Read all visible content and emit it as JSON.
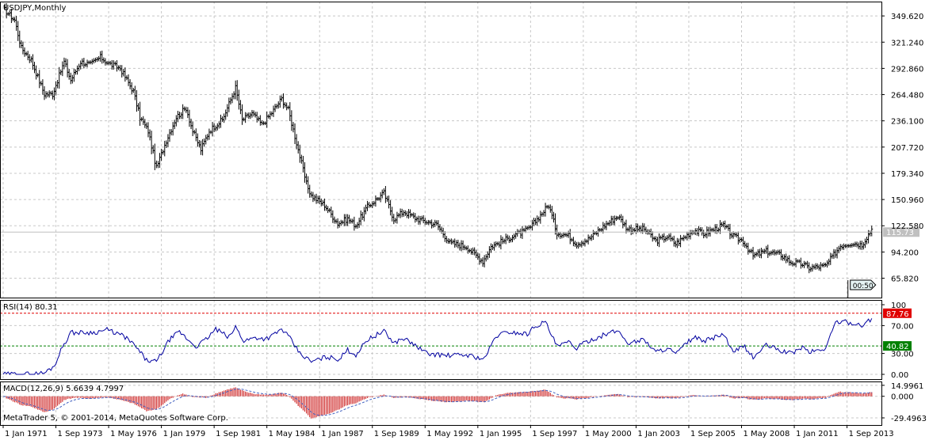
{
  "chart_data": [
    {
      "type": "ohlc",
      "symbol_label": "USDJPY,Monthly",
      "ylim": [
        50,
        360
      ],
      "yticks": [
        349.62,
        321.24,
        292.86,
        264.48,
        236.1,
        207.72,
        179.34,
        150.96,
        122.58,
        94.2,
        65.82
      ],
      "ytick_labels": [
        "349.620",
        "321.240",
        "292.860",
        "264.480",
        "236.100",
        "207.720",
        "179.340",
        "150.960",
        "122.580",
        "94.200",
        "65.820"
      ],
      "last_price": 115.73,
      "last_price_label": "115.73",
      "timer_label": "00:50",
      "colors": {
        "bars": "#000000",
        "price_line": "#c0c0c0",
        "price_label_bg": "#c0c0c0"
      },
      "anchors": [
        [
          "1971-01",
          358
        ],
        [
          "1971-08",
          345
        ],
        [
          "1971-12",
          315
        ],
        [
          "1972-06",
          302
        ],
        [
          "1973-02",
          265
        ],
        [
          "1973-07",
          265
        ],
        [
          "1974-02",
          300
        ],
        [
          "1974-06",
          280
        ],
        [
          "1974-12",
          300
        ],
        [
          "1975-06",
          297
        ],
        [
          "1975-12",
          305
        ],
        [
          "1976-05",
          298
        ],
        [
          "1976-12",
          293
        ],
        [
          "1977-08",
          268
        ],
        [
          "1977-12",
          240
        ],
        [
          "1978-05",
          225
        ],
        [
          "1978-10",
          185
        ],
        [
          "1979-04",
          215
        ],
        [
          "1979-10",
          240
        ],
        [
          "1980-04",
          250
        ],
        [
          "1980-08",
          225
        ],
        [
          "1981-01",
          205
        ],
        [
          "1981-06",
          225
        ],
        [
          "1981-09",
          230
        ],
        [
          "1982-02",
          237
        ],
        [
          "1982-10",
          272
        ],
        [
          "1983-02",
          237
        ],
        [
          "1983-08",
          244
        ],
        [
          "1984-02",
          232
        ],
        [
          "1984-08",
          245
        ],
        [
          "1985-02",
          260
        ],
        [
          "1985-06",
          248
        ],
        [
          "1985-12",
          205
        ],
        [
          "1986-05",
          168
        ],
        [
          "1986-08",
          155
        ],
        [
          "1987-04",
          145
        ],
        [
          "1987-12",
          125
        ],
        [
          "1988-06",
          130
        ],
        [
          "1988-11",
          123
        ],
        [
          "1989-06",
          143
        ],
        [
          "1990-04",
          158
        ],
        [
          "1990-10",
          130
        ],
        [
          "1991-04",
          138
        ],
        [
          "1991-12",
          130
        ],
        [
          "1992-06",
          127
        ],
        [
          "1992-12",
          124
        ],
        [
          "1993-08",
          104
        ],
        [
          "1994-06",
          100
        ],
        [
          "1995-04",
          84
        ],
        [
          "1995-09",
          100
        ],
        [
          "1996-04",
          106
        ],
        [
          "1996-12",
          113
        ],
        [
          "1997-05",
          116
        ],
        [
          "1997-09",
          121
        ],
        [
          "1998-08",
          145
        ],
        [
          "1999-01",
          115
        ],
        [
          "1999-08",
          112
        ],
        [
          "2000-01",
          103
        ],
        [
          "2000-08",
          108
        ],
        [
          "2001-06",
          123
        ],
        [
          "2002-02",
          133
        ],
        [
          "2002-08",
          119
        ],
        [
          "2003-06",
          119
        ],
        [
          "2004-01",
          106
        ],
        [
          "2004-08",
          111
        ],
        [
          "2005-01",
          103
        ],
        [
          "2005-12",
          118
        ],
        [
          "2006-06",
          114
        ],
        [
          "2007-06",
          123
        ],
        [
          "2007-12",
          111
        ],
        [
          "2008-06",
          106
        ],
        [
          "2008-12",
          90
        ],
        [
          "2009-08",
          95
        ],
        [
          "2010-05",
          91
        ],
        [
          "2010-11",
          83
        ],
        [
          "2011-06",
          81
        ],
        [
          "2011-10",
          77
        ],
        [
          "2012-08",
          79
        ],
        [
          "2013-05",
          101
        ],
        [
          "2013-12",
          104
        ],
        [
          "2014-06",
          102
        ],
        [
          "2014-12",
          119
        ]
      ]
    },
    {
      "type": "line",
      "label": "RSI(14) 80.31",
      "ylim": [
        0,
        100
      ],
      "yticks": [
        100,
        70,
        30,
        0
      ],
      "ytick_labels": [
        "100",
        "70.00",
        "30.00",
        "0.00"
      ],
      "levels": [
        87.76,
        40.82
      ],
      "level_labels": [
        "87.76",
        "40.82"
      ],
      "colors": {
        "line": "#0000a0",
        "upper_level": "#e00000",
        "lower_level": "#008000",
        "upper_label_bg": "#e00000",
        "lower_label_bg": "#008000"
      },
      "anchors": [
        [
          "1971-01",
          0
        ],
        [
          "1972-06",
          0.5
        ],
        [
          "1973-02",
          2
        ],
        [
          "1973-08",
          12
        ],
        [
          "1974-01",
          40
        ],
        [
          "1974-06",
          60
        ],
        [
          "1974-12",
          60
        ],
        [
          "1975-08",
          60
        ],
        [
          "1976-04",
          64
        ],
        [
          "1976-12",
          57
        ],
        [
          "1977-04",
          52
        ],
        [
          "1977-10",
          38
        ],
        [
          "1978-04",
          20
        ],
        [
          "1978-10",
          18
        ],
        [
          "1979-06",
          50
        ],
        [
          "1979-12",
          61
        ],
        [
          "1980-05",
          50
        ],
        [
          "1980-10",
          40
        ],
        [
          "1981-04",
          50
        ],
        [
          "1981-10",
          65
        ],
        [
          "1982-06",
          53
        ],
        [
          "1982-10",
          68
        ],
        [
          "1983-03",
          48
        ],
        [
          "1983-10",
          53
        ],
        [
          "1984-04",
          51
        ],
        [
          "1984-08",
          55
        ],
        [
          "1985-02",
          65
        ],
        [
          "1985-06",
          55
        ],
        [
          "1986-01",
          30
        ],
        [
          "1986-08",
          18
        ],
        [
          "1987-05",
          25
        ],
        [
          "1988-01",
          22
        ],
        [
          "1988-06",
          35
        ],
        [
          "1988-11",
          28
        ],
        [
          "1989-06",
          50
        ],
        [
          "1990-04",
          62
        ],
        [
          "1990-10",
          45
        ],
        [
          "1991-04",
          52
        ],
        [
          "1991-12",
          40
        ],
        [
          "1992-06",
          30
        ],
        [
          "1993-06",
          27
        ],
        [
          "1994-06",
          28
        ],
        [
          "1995-05",
          22
        ],
        [
          "1995-12",
          55
        ],
        [
          "1996-07",
          61
        ],
        [
          "1997-07",
          58
        ],
        [
          "1997-12",
          70
        ],
        [
          "1998-06",
          75
        ],
        [
          "1999-01",
          40
        ],
        [
          "1999-08",
          46
        ],
        [
          "2000-01",
          38
        ],
        [
          "2000-08",
          48
        ],
        [
          "2001-06",
          57
        ],
        [
          "2002-02",
          63
        ],
        [
          "2002-08",
          45
        ],
        [
          "2003-06",
          50
        ],
        [
          "2004-01",
          32
        ],
        [
          "2004-08",
          38
        ],
        [
          "2005-01",
          29
        ],
        [
          "2005-12",
          54
        ],
        [
          "2006-06",
          47
        ],
        [
          "2007-06",
          58
        ],
        [
          "2007-12",
          30
        ],
        [
          "2008-06",
          42
        ],
        [
          "2008-12",
          24
        ],
        [
          "2009-08",
          42
        ],
        [
          "2010-05",
          34
        ],
        [
          "2010-11",
          30
        ],
        [
          "2011-06",
          39
        ],
        [
          "2011-10",
          32
        ],
        [
          "2012-08",
          37
        ],
        [
          "2013-02",
          75
        ],
        [
          "2013-05",
          76
        ],
        [
          "2013-12",
          74
        ],
        [
          "2014-06",
          70
        ],
        [
          "2014-12",
          80.31
        ]
      ]
    },
    {
      "type": "bar",
      "label": "MACD(12,26,9) 5.6639 4.7997",
      "ylim": [
        -36,
        17
      ],
      "yticks": [
        14.9961,
        0,
        -29.4963
      ],
      "ytick_labels": [
        "14.9961",
        "0.000",
        "-29.4963"
      ],
      "colors": {
        "bars": "#d03030",
        "signal": "#4060c0"
      },
      "anchors": [
        [
          "1971-01",
          -0.5
        ],
        [
          "1971-12",
          -12
        ],
        [
          "1972-06",
          -14
        ],
        [
          "1973-02",
          -22
        ],
        [
          "1973-08",
          -17
        ],
        [
          "1974-02",
          -5
        ],
        [
          "1974-08",
          -2
        ],
        [
          "1975-06",
          -3
        ],
        [
          "1976-04",
          -1
        ],
        [
          "1976-12",
          -5
        ],
        [
          "1977-08",
          -10
        ],
        [
          "1978-04",
          -20
        ],
        [
          "1978-10",
          -18
        ],
        [
          "1979-06",
          -4
        ],
        [
          "1980-02",
          4
        ],
        [
          "1980-08",
          -1
        ],
        [
          "1981-04",
          -2
        ],
        [
          "1981-10",
          4
        ],
        [
          "1982-06",
          10
        ],
        [
          "1982-10",
          12
        ],
        [
          "1983-04",
          6
        ],
        [
          "1983-10",
          3
        ],
        [
          "1984-06",
          2
        ],
        [
          "1985-02",
          5
        ],
        [
          "1985-06",
          1
        ],
        [
          "1986-01",
          -15
        ],
        [
          "1986-08",
          -30
        ],
        [
          "1987-05",
          -25
        ],
        [
          "1988-01",
          -18
        ],
        [
          "1988-06",
          -12
        ],
        [
          "1988-11",
          -10
        ],
        [
          "1989-06",
          -2
        ],
        [
          "1990-04",
          2
        ],
        [
          "1990-10",
          -2
        ],
        [
          "1991-04",
          -1
        ],
        [
          "1991-12",
          -3
        ],
        [
          "1992-06",
          -5
        ],
        [
          "1993-06",
          -8
        ],
        [
          "1994-06",
          -6
        ],
        [
          "1995-05",
          -8
        ],
        [
          "1995-12",
          1
        ],
        [
          "1996-07",
          5
        ],
        [
          "1997-07",
          6
        ],
        [
          "1998-06",
          9
        ],
        [
          "1999-01",
          -2
        ],
        [
          "1999-08",
          -3
        ],
        [
          "2000-01",
          -4
        ],
        [
          "2000-08",
          -2
        ],
        [
          "2001-06",
          1
        ],
        [
          "2002-02",
          3
        ],
        [
          "2002-08",
          -1
        ],
        [
          "2003-06",
          -1
        ],
        [
          "2004-01",
          -3
        ],
        [
          "2004-08",
          -2
        ],
        [
          "2005-01",
          -3
        ],
        [
          "2005-12",
          2
        ],
        [
          "2006-06",
          0
        ],
        [
          "2007-06",
          2
        ],
        [
          "2007-12",
          -3
        ],
        [
          "2008-06",
          -2
        ],
        [
          "2008-12",
          -5
        ],
        [
          "2009-08",
          -3
        ],
        [
          "2010-05",
          -4
        ],
        [
          "2010-11",
          -5
        ],
        [
          "2011-06",
          -3
        ],
        [
          "2011-10",
          -4
        ],
        [
          "2012-08",
          -2
        ],
        [
          "2013-02",
          5
        ],
        [
          "2013-05",
          6
        ],
        [
          "2013-12",
          5
        ],
        [
          "2014-06",
          4
        ],
        [
          "2014-12",
          5.6639
        ]
      ]
    }
  ],
  "xaxis": {
    "range": [
      "1971-01",
      "2015-03"
    ],
    "ticks": [
      {
        "date": "1971-01",
        "label": "1 Jan 1971"
      },
      {
        "date": "1973-09",
        "label": "1 Sep 1973"
      },
      {
        "date": "1976-05",
        "label": "1 May 1976"
      },
      {
        "date": "1979-01",
        "label": "1 Jan 1979"
      },
      {
        "date": "1981-09",
        "label": "1 Sep 1981"
      },
      {
        "date": "1984-05",
        "label": "1 May 1984"
      },
      {
        "date": "1987-01",
        "label": "1 Jan 1987"
      },
      {
        "date": "1989-09",
        "label": "1 Sep 1989"
      },
      {
        "date": "1992-05",
        "label": "1 May 1992"
      },
      {
        "date": "1995-01",
        "label": "1 Jan 1995"
      },
      {
        "date": "1997-09",
        "label": "1 Sep 1997"
      },
      {
        "date": "2000-05",
        "label": "1 May 2000"
      },
      {
        "date": "2003-01",
        "label": "1 Jan 2003"
      },
      {
        "date": "2005-09",
        "label": "1 Sep 2005"
      },
      {
        "date": "2008-05",
        "label": "1 May 2008"
      },
      {
        "date": "2011-01",
        "label": "1 Jan 2011"
      },
      {
        "date": "2013-09",
        "label": "1 Sep 2013"
      }
    ]
  },
  "copyright": "MetaTrader 5, © 2001-2014, MetaQuotes Software Corp.",
  "grid": true
}
